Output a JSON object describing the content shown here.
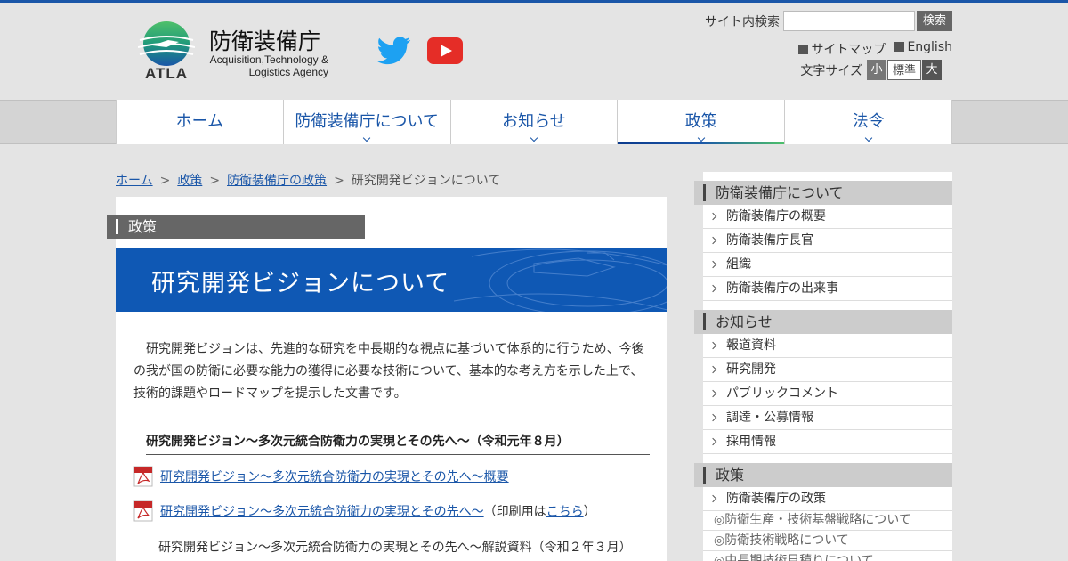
{
  "header": {
    "logo_text": "ATLA",
    "agency_ja": "防衛装備庁",
    "agency_en_line1": "Acquisition,Technology &",
    "agency_en_line2": "Logistics Agency",
    "search_label": "サイト内検索",
    "search_placeholder": "",
    "search_button": "検索",
    "sitemap": "サイトマップ",
    "english": "English",
    "fontsize_label": "文字サイズ",
    "fontsize_small": "小",
    "fontsize_medium": "標準",
    "fontsize_large": "大"
  },
  "nav": {
    "items": [
      {
        "label": "ホーム"
      },
      {
        "label": "防衛装備庁について"
      },
      {
        "label": "お知らせ"
      },
      {
        "label": "政策"
      },
      {
        "label": "法令"
      }
    ]
  },
  "breadcrumb": {
    "items": [
      "ホーム",
      "政策",
      "防衛装備庁の政策"
    ],
    "current": "研究開発ビジョンについて",
    "separator": ">"
  },
  "main": {
    "section_label": "政策",
    "title": "研究開発ビジョンについて",
    "intro": "　研究開発ビジョンは、先進的な研究を中長期的な視点に基づいて体系的に行うため、今後の我が国の防衛に必要な能力の獲得に必要な技術について、基本的な考え方を示した上で、技術的課題やロードマップを提示した文書です。",
    "sub_heading": "研究開発ビジョン～多次元統合防衛力の実現とその先へ～（令和元年８月）",
    "link1": "研究開発ビジョン～多次元統合防衛力の実現とその先へ～概要",
    "link2": "研究開発ビジョン～多次元統合防衛力の実現とその先へ～",
    "link2_suffix_pre": "（印刷用は",
    "link2_suffix_link": "こちら",
    "link2_suffix_post": "）",
    "plain_item": "研究開発ビジョン～多次元統合防衛力の実現とその先へ～解説資料（令和２年３月）"
  },
  "sidebar": {
    "sections": [
      {
        "heading": "防衛装備庁について",
        "items": [
          "防衛装備庁の概要",
          "防衛装備庁長官",
          "組織",
          "防衛装備庁の出来事"
        ]
      },
      {
        "heading": "お知らせ",
        "items": [
          "報道資料",
          "研究開発",
          "パブリックコメント",
          "調達・公募情報",
          "採用情報"
        ]
      },
      {
        "heading": "政策",
        "items": [
          "防衛装備庁の政策"
        ],
        "sub_items": [
          "◎防衛生産・技術基盤戦略について",
          "◎防衛技術戦略について",
          "◎中長期技術見積りについて"
        ]
      }
    ]
  },
  "colors": {
    "accent": "#1a56a8",
    "banner": "#0f58b4",
    "youtube": "#e52d27",
    "twitter": "#1da1f2"
  }
}
